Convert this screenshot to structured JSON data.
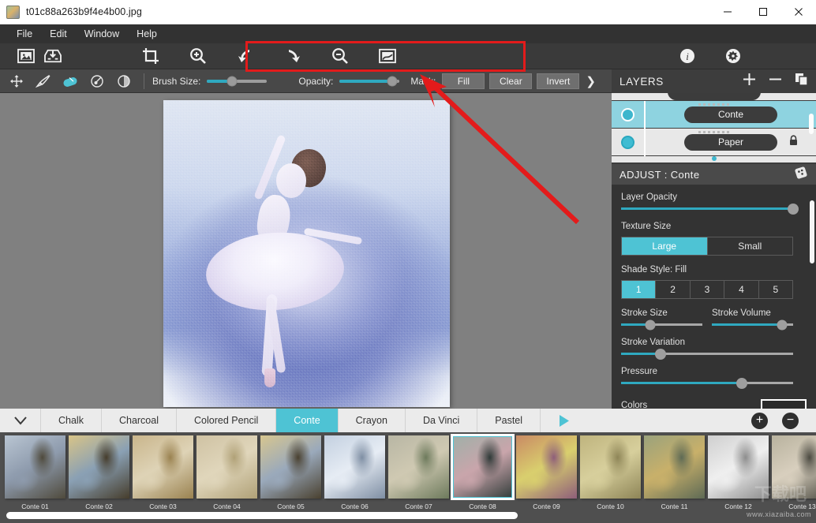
{
  "window": {
    "title": "t01c88a263b9f4e4b00.jpg",
    "icon": "image-file-icon",
    "controls": [
      {
        "name": "minimize-button",
        "glyph": "minimize-icon"
      },
      {
        "name": "maximize-button",
        "glyph": "maximize-icon"
      },
      {
        "name": "close-button",
        "glyph": "close-icon"
      }
    ]
  },
  "menubar": {
    "items": [
      {
        "label": "File"
      },
      {
        "label": "Edit"
      },
      {
        "label": "Window"
      },
      {
        "label": "Help"
      }
    ]
  },
  "toolbar": {
    "left_icons": [
      {
        "name": "open-image-icon",
        "tooltip": "Open Image"
      },
      {
        "name": "save-image-icon",
        "tooltip": "Save Image"
      }
    ],
    "highlighted_icons": [
      {
        "name": "crop-icon",
        "tooltip": "Crop"
      },
      {
        "name": "zoom-in-icon",
        "tooltip": "Zoom In"
      },
      {
        "name": "undo-icon",
        "tooltip": "Undo"
      },
      {
        "name": "redo-icon",
        "tooltip": "Redo"
      },
      {
        "name": "zoom-out-icon",
        "tooltip": "Zoom Out"
      },
      {
        "name": "fit-image-icon",
        "tooltip": "Fit To Screen"
      }
    ],
    "right_icons": [
      {
        "name": "info-icon",
        "tooltip": "Info"
      },
      {
        "name": "settings-icon",
        "tooltip": "Settings"
      }
    ],
    "annotation": {
      "type": "red-highlight-box",
      "arrow": "red-arrow",
      "color": "#e31b1b"
    }
  },
  "subtoolbar": {
    "tools": [
      {
        "name": "move-tool",
        "icon": "move-arrows-icon",
        "active": false
      },
      {
        "name": "brush-tool",
        "icon": "paintbrush-icon",
        "active": false
      },
      {
        "name": "eraser-tool",
        "icon": "eraser-icon",
        "active": true
      },
      {
        "name": "smudge-tool",
        "icon": "smudge-icon",
        "active": false
      },
      {
        "name": "blur-tool",
        "icon": "blur-icon",
        "active": false
      }
    ],
    "brush_size": {
      "label": "Brush Size:",
      "value": 42
    },
    "opacity": {
      "label": "Opacity:",
      "value": 88
    },
    "mask": {
      "label": "Mask:",
      "buttons": [
        {
          "label": "Fill"
        },
        {
          "label": "Clear"
        },
        {
          "label": "Invert"
        }
      ],
      "more": "chevron-right-icon"
    }
  },
  "canvas": {
    "artwork_alt": "Ballerina rendered in blue and white conte texture"
  },
  "layers": {
    "title": "LAYERS",
    "actions": [
      {
        "name": "add-layer-button",
        "icon": "plus-icon"
      },
      {
        "name": "remove-layer-button",
        "icon": "minus-icon"
      },
      {
        "name": "duplicate-layer-button",
        "icon": "copy-icon"
      }
    ],
    "rows": [
      {
        "label": "Conte",
        "selected": true,
        "locked": false
      },
      {
        "label": "Paper",
        "selected": false,
        "locked": true
      }
    ]
  },
  "adjust": {
    "title": "ADJUST : Conte",
    "head_icon": "dice-icon",
    "layer_opacity": {
      "label": "Layer Opacity",
      "value": 100
    },
    "texture_size": {
      "label": "Texture Size",
      "options": [
        {
          "label": "Large",
          "on": true
        },
        {
          "label": "Small",
          "on": false
        }
      ]
    },
    "shade_style": {
      "label": "Shade Style: Fill",
      "options": [
        {
          "label": "1",
          "on": true
        },
        {
          "label": "2",
          "on": false
        },
        {
          "label": "3",
          "on": false
        },
        {
          "label": "4",
          "on": false
        },
        {
          "label": "5",
          "on": false
        }
      ]
    },
    "stroke_size": {
      "label": "Stroke Size",
      "value": 36
    },
    "stroke_volume": {
      "label": "Stroke Volume",
      "value": 86
    },
    "stroke_variation": {
      "label": "Stroke Variation",
      "value": 23
    },
    "pressure": {
      "label": "Pressure",
      "value": 70
    },
    "colors": {
      "label": "Colors"
    }
  },
  "presets": {
    "collapse_icon": "chevron-down-icon",
    "tabs": [
      {
        "label": "Chalk",
        "on": false
      },
      {
        "label": "Charcoal",
        "on": false
      },
      {
        "label": "Colored Pencil",
        "on": false
      },
      {
        "label": "Conte",
        "on": true
      },
      {
        "label": "Crayon",
        "on": false
      },
      {
        "label": "Da Vinci",
        "on": false
      },
      {
        "label": "Pastel",
        "on": false
      }
    ],
    "play_icon": "play-icon",
    "buttons": [
      {
        "name": "add-preset-button",
        "icon": "plus-circle-icon",
        "glyph": "+"
      },
      {
        "name": "remove-preset-button",
        "icon": "minus-circle-icon",
        "glyph": "−"
      }
    ],
    "thumbnails": [
      {
        "label": "Conte 01",
        "selected": false,
        "c1": "#b9c5d2",
        "c2": "#4f4a3c",
        "c3": "#8e9bad"
      },
      {
        "label": "Conte 02",
        "selected": false,
        "c1": "#d8c487",
        "c2": "#463d2c",
        "c3": "#8aa0b4"
      },
      {
        "label": "Conte 03",
        "selected": false,
        "c1": "#c9b58b",
        "c2": "#9a8250",
        "c3": "#ded3b6"
      },
      {
        "label": "Conte 04",
        "selected": false,
        "c1": "#cfc2a3",
        "c2": "#b0a177",
        "c3": "#e0d6bb"
      },
      {
        "label": "Conte 05",
        "selected": false,
        "c1": "#d7c68f",
        "c2": "#4a4130",
        "c3": "#9aa9bb"
      },
      {
        "label": "Conte 06",
        "selected": false,
        "c1": "#c3d0e0",
        "c2": "#7e8ea3",
        "c3": "#e6ecf4"
      },
      {
        "label": "Conte 07",
        "selected": false,
        "c1": "#b8b6a4",
        "c2": "#6d7a5c",
        "c3": "#cfc9b2"
      },
      {
        "label": "Conte 08",
        "selected": true,
        "c1": "#9fb0a8",
        "c2": "#2f3a38",
        "c3": "#c9a5ab"
      },
      {
        "label": "Conte 09",
        "selected": false,
        "c1": "#c98a64",
        "c2": "#8e5e7a",
        "c3": "#d9cf6e"
      },
      {
        "label": "Conte 10",
        "selected": false,
        "c1": "#bfb47e",
        "c2": "#8e8557",
        "c3": "#d7cf9c"
      },
      {
        "label": "Conte 11",
        "selected": false,
        "c1": "#9aa27c",
        "c2": "#5e6a55",
        "c3": "#c8b06a"
      },
      {
        "label": "Conte 12",
        "selected": false,
        "c1": "#cfcfcf",
        "c2": "#8d8d8d",
        "c3": "#efefef"
      },
      {
        "label": "Conte 13",
        "selected": false,
        "c1": "#b8b29e",
        "c2": "#4b4a41",
        "c3": "#d8cfbe"
      }
    ]
  },
  "watermark": {
    "small": "www.xiazaiba.com",
    "big": "下载吧"
  }
}
